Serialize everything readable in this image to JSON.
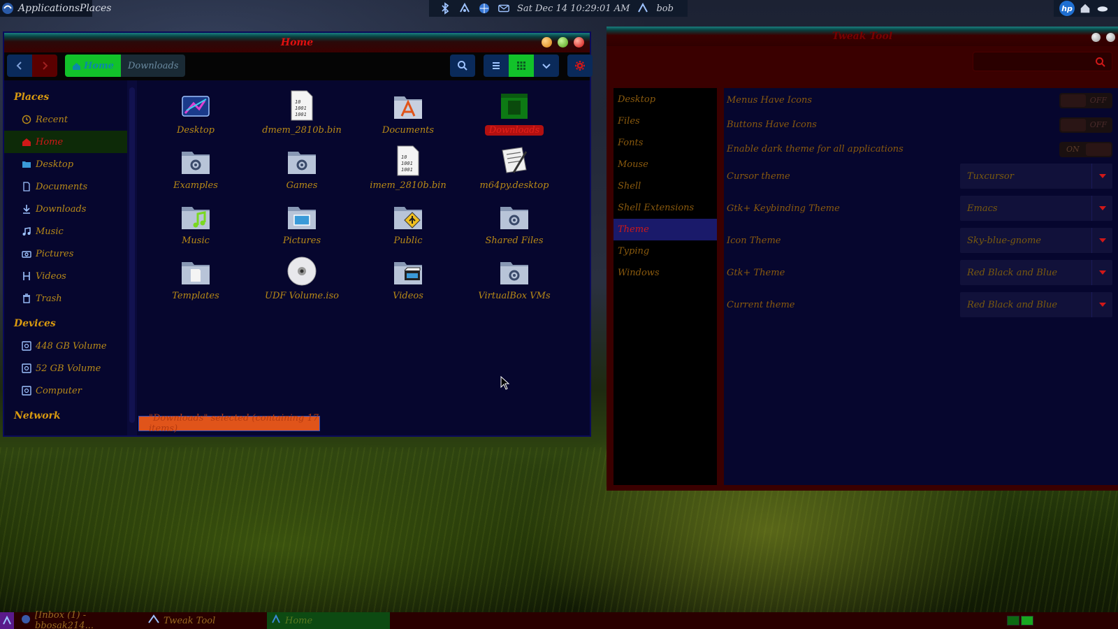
{
  "top_panel": {
    "menu_label": "ApplicationsPlaces",
    "clock": "Sat Dec 14  10:29:01 AM",
    "user": "bob"
  },
  "file_manager": {
    "title": "Home",
    "path": [
      "Home",
      "Downloads"
    ],
    "sidebar": {
      "places_heading": "Places",
      "places": [
        "Recent",
        "Home",
        "Desktop",
        "Documents",
        "Downloads",
        "Music",
        "Pictures",
        "Videos",
        "Trash"
      ],
      "devices_heading": "Devices",
      "devices": [
        "448 GB Volume",
        "52 GB Volume",
        "Computer"
      ],
      "network_heading": "Network"
    },
    "items": [
      {
        "label": "Desktop",
        "icon": "desktop-icon"
      },
      {
        "label": "dmem_2810b.bin",
        "icon": "binary-file-icon"
      },
      {
        "label": "Documents",
        "icon": "documents-folder-icon"
      },
      {
        "label": "Downloads",
        "icon": "downloads-folder-icon"
      },
      {
        "label": "Examples",
        "icon": "folder-icon"
      },
      {
        "label": "Games",
        "icon": "folder-icon"
      },
      {
        "label": "imem_2810b.bin",
        "icon": "binary-file-icon"
      },
      {
        "label": "m64py.desktop",
        "icon": "desktop-file-icon"
      },
      {
        "label": "Music",
        "icon": "music-folder-icon"
      },
      {
        "label": "Pictures",
        "icon": "pictures-folder-icon"
      },
      {
        "label": "Public",
        "icon": "public-folder-icon"
      },
      {
        "label": "Shared Files",
        "icon": "folder-icon"
      },
      {
        "label": "Templates",
        "icon": "templates-folder-icon"
      },
      {
        "label": "UDF Volume.iso",
        "icon": "disc-icon"
      },
      {
        "label": "Videos",
        "icon": "videos-folder-icon"
      },
      {
        "label": "VirtualBox VMs",
        "icon": "folder-icon"
      }
    ],
    "selected_item": "Downloads",
    "status": "\"Downloads\" selected (containing 17 items)"
  },
  "tweak_tool": {
    "title": "Tweak Tool",
    "nav": [
      "Desktop",
      "Files",
      "Fonts",
      "Mouse",
      "Shell",
      "Shell Extensions",
      "Theme",
      "Typing",
      "Windows"
    ],
    "active_nav": "Theme",
    "toggles": [
      {
        "label": "Menus Have Icons",
        "state": "OFF"
      },
      {
        "label": "Buttons Have Icons",
        "state": "OFF"
      },
      {
        "label": "Enable dark theme for all applications",
        "state": "ON"
      }
    ],
    "dropdowns": [
      {
        "label": "Cursor theme",
        "value": "Tuxcursor"
      },
      {
        "label": "Gtk+ Keybinding Theme",
        "value": "Emacs"
      },
      {
        "label": "Icon Theme",
        "value": "Sky-blue-gnome"
      },
      {
        "label": "Gtk+ Theme",
        "value": "Red Black and Blue"
      },
      {
        "label": "Current theme",
        "value": "Red Black and Blue"
      }
    ]
  },
  "taskbar": {
    "tasks": [
      "[Inbox (1) - bbosak214...",
      "Tweak Tool",
      "Home"
    ],
    "active_task": "Home"
  },
  "colors": {
    "accent_red": "#d01818",
    "accent_green": "#12c22a",
    "window_bg": "#06062e",
    "label_amber": "#b98a16"
  }
}
